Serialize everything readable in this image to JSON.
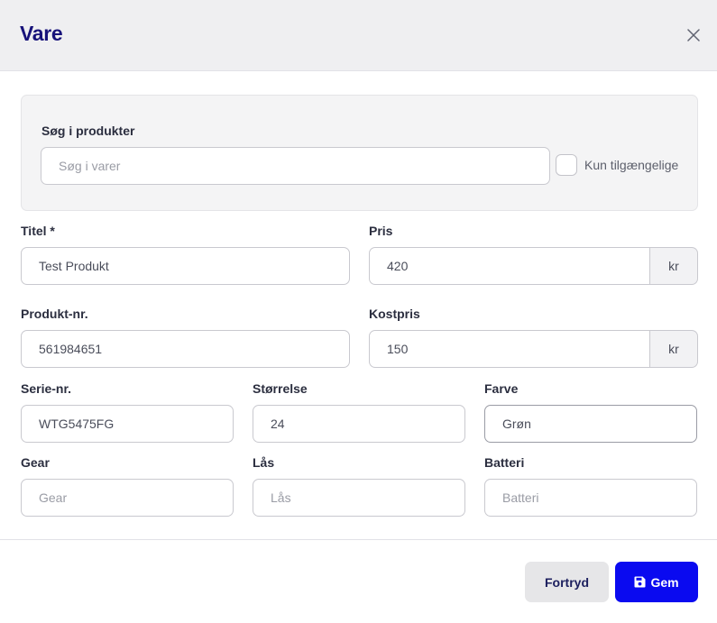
{
  "modal": {
    "title": "Vare",
    "close_icon": "close-icon"
  },
  "search": {
    "label": "Søg i produkter",
    "placeholder": "Søg i varer",
    "value": "",
    "only_available_label": "Kun tilgængelige",
    "only_available_checked": false
  },
  "fields": {
    "title": {
      "label": "Titel *",
      "value": "Test Produkt",
      "placeholder": ""
    },
    "price": {
      "label": "Pris",
      "value": "420",
      "unit": "kr"
    },
    "product_no": {
      "label": "Produkt-nr.",
      "value": "561984651"
    },
    "cost_price": {
      "label": "Kostpris",
      "value": "150",
      "unit": "kr"
    },
    "serial_no": {
      "label": "Serie-nr.",
      "value": "WTG5475FG"
    },
    "size": {
      "label": "Størrelse",
      "value": "24"
    },
    "color": {
      "label": "Farve",
      "value": "Grøn"
    },
    "gear": {
      "label": "Gear",
      "value": "",
      "placeholder": "Gear"
    },
    "lock": {
      "label": "Lås",
      "value": "",
      "placeholder": "Lås"
    },
    "battery": {
      "label": "Batteri",
      "value": "",
      "placeholder": "Batteri"
    }
  },
  "footer": {
    "cancel_label": "Fortryd",
    "save_label": "Gem",
    "save_icon": "save-icon"
  },
  "colors": {
    "title": "#17127a",
    "primary": "#0a0af0",
    "cancel_bg": "#e6e6e8"
  }
}
